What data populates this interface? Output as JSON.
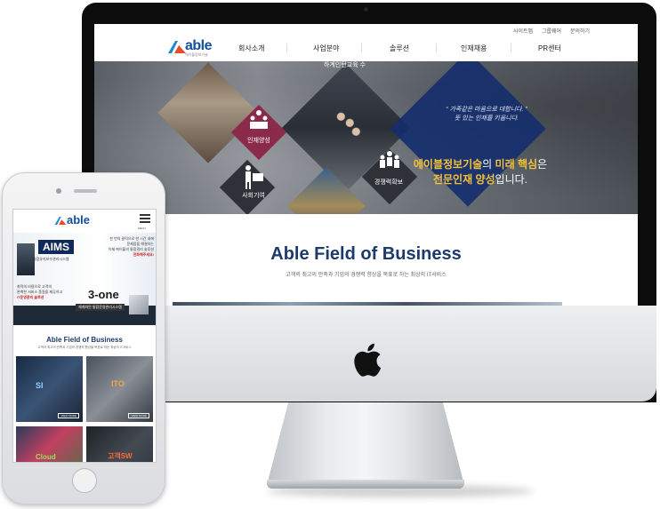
{
  "desktop": {
    "top_links": [
      "사이트맵",
      "그룹웨어",
      "문의하기"
    ],
    "logo_text": "able",
    "logo_sub": "에이블정보기술",
    "nav": [
      "회사소개",
      "사업분야",
      "솔루션",
      "인재채용",
      "PR센터"
    ],
    "hero": {
      "icons": [
        {
          "label": "인재양성",
          "icon": "people-podium-icon"
        },
        {
          "label": "사회기여",
          "icon": "helping-hand-icon"
        },
        {
          "label": "경쟁력확보",
          "icon": "team-group-icon"
        }
      ],
      "quote_line1": "가족같은 마음으로 대합니다.",
      "quote_line2": "뜻 있는 인재를 키웁니다.",
      "main_part1": "에이블정보기술",
      "main_part2": "의 ",
      "main_part3": "미래 핵심",
      "main_part4": "은",
      "main_part5": "전문인재 양성",
      "main_part6": "입니다.",
      "banner_text": "하계인턴교육 수"
    },
    "section": {
      "title": "Able Field of Business",
      "subtitle": "고객의 최고의 만족과 기업의 경쟁력 향상을 목표로 하는 최상의 IT서비스"
    }
  },
  "mobile": {
    "logo_text": "able",
    "menu_label": "MENU",
    "banner": {
      "aims": "AIMS",
      "aims_sub": "통합유지보수관리시스템",
      "promo_1": "한 번의 클릭으로 한 시간 내에",
      "promo_2": "문제점을 해결하는",
      "promo_3": "이제 에이블의 통합관리 솔루션",
      "promo_highlight": "전화해주세요!",
      "left_1": "최적의 비용으로 고객의",
      "left_2": "완벽한 서비스 품질을 제공하고",
      "left_3": "IT운영관리 솔루션",
      "threeone": "3-one",
      "threeone_sub": "체계화된 통합운영관리시스템"
    },
    "section": {
      "title": "Able Field of Business",
      "subtitle": "고객의 최고의 만족과 기업의 경쟁력 향상을 목표로 하는 최상의 IT서비스"
    },
    "tiles": [
      {
        "label": "SI",
        "button": "VIEW MORE"
      },
      {
        "label": "ITO",
        "button": "VIEW MORE"
      },
      {
        "label": "Cloud",
        "button": ""
      },
      {
        "label": "고객SW",
        "button": ""
      }
    ]
  }
}
